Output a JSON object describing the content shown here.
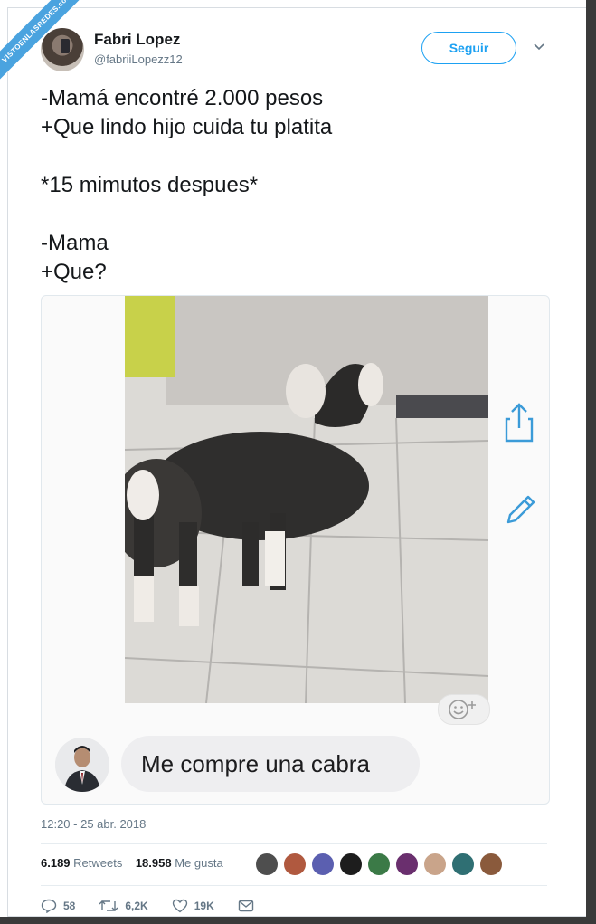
{
  "watermark": "VISTOENLASREDES.com",
  "author": {
    "name": "Fabri Lopez",
    "handle": "@fabriiLopezz12"
  },
  "follow_label": "Seguir",
  "tweet_text": "-Mamá encontré 2.000 pesos\n+Que lindo hijo cuida tu platita\n\n*15 mimutos despues*\n\n-Mama\n+Que?",
  "media": {
    "message": "Me compre una cabra"
  },
  "timestamp": "12:20 - 25 abr. 2018",
  "stats": {
    "retweets_count": "6.189",
    "retweets_label": "Retweets",
    "likes_count": "18.958",
    "likes_label": "Me gusta"
  },
  "actions": {
    "replies": "58",
    "retweets": "6,2K",
    "likes": "19K"
  },
  "colors": {
    "accent": "#1da1f2",
    "muted": "#657786",
    "text": "#14171a"
  },
  "icons": [
    "chevron-down-icon",
    "share-icon",
    "edit-icon",
    "emoji-icon",
    "reply-icon",
    "retweet-icon",
    "like-icon",
    "message-icon"
  ]
}
